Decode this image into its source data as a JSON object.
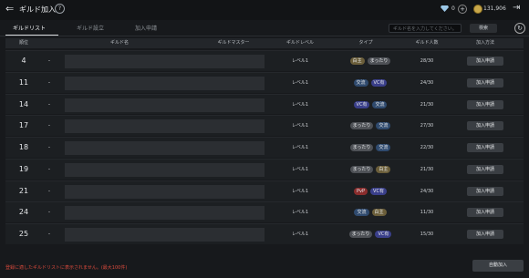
{
  "header": {
    "back_icon": "back-arrow-icon",
    "title": "ギルド加入",
    "help_glyph": "?",
    "gem_value": "0",
    "plus_glyph": "+",
    "gold_value": "131,906",
    "exit_icon": "exit-icon"
  },
  "tabs": [
    {
      "label": "ギルドリスト",
      "active": true
    },
    {
      "label": "ギルド設立",
      "active": false
    },
    {
      "label": "加入申請",
      "active": false
    }
  ],
  "search": {
    "placeholder": "ギルド名を入力してください。",
    "button_label": "検索",
    "refresh_icon": "refresh-icon"
  },
  "table": {
    "headers": {
      "rank": "順位",
      "name": "ギルド名",
      "master": "ギルドマスター",
      "level": "ギルドレベル",
      "type": "タイプ",
      "members": "ギルド人数",
      "method": "加入方法"
    },
    "rows": [
      {
        "rank": "4",
        "dash": "-",
        "level": "レベル1",
        "tags": [
          {
            "label": "白主",
            "kind": "shiro"
          },
          {
            "label": "まったり",
            "kind": "mattari"
          }
        ],
        "members": "28/30",
        "button": "加入申請"
      },
      {
        "rank": "11",
        "dash": "-",
        "level": "レベル1",
        "tags": [
          {
            "label": "交流",
            "kind": "koryu"
          },
          {
            "label": "VC有",
            "kind": "vc"
          }
        ],
        "members": "24/30",
        "button": "加入申請"
      },
      {
        "rank": "14",
        "dash": "-",
        "level": "レベル1",
        "tags": [
          {
            "label": "VC有",
            "kind": "vc"
          },
          {
            "label": "交流",
            "kind": "koryu"
          }
        ],
        "members": "21/30",
        "button": "加入申請"
      },
      {
        "rank": "17",
        "dash": "-",
        "level": "レベル1",
        "tags": [
          {
            "label": "まったり",
            "kind": "mattari"
          },
          {
            "label": "交流",
            "kind": "koryu"
          }
        ],
        "members": "27/30",
        "button": "加入申請"
      },
      {
        "rank": "18",
        "dash": "-",
        "level": "レベル1",
        "tags": [
          {
            "label": "まったり",
            "kind": "mattari"
          },
          {
            "label": "交流",
            "kind": "koryu"
          }
        ],
        "members": "22/30",
        "button": "加入申請"
      },
      {
        "rank": "19",
        "dash": "-",
        "level": "レベル1",
        "tags": [
          {
            "label": "まったり",
            "kind": "mattari"
          },
          {
            "label": "白主",
            "kind": "shiro"
          }
        ],
        "members": "21/30",
        "button": "加入申請"
      },
      {
        "rank": "21",
        "dash": "-",
        "level": "レベル1",
        "tags": [
          {
            "label": "PvP",
            "kind": "pvp"
          },
          {
            "label": "VC有",
            "kind": "vc"
          }
        ],
        "members": "24/30",
        "button": "加入申請"
      },
      {
        "rank": "24",
        "dash": "-",
        "level": "レベル1",
        "tags": [
          {
            "label": "交流",
            "kind": "koryu"
          },
          {
            "label": "白主",
            "kind": "shiro"
          }
        ],
        "members": "11/30",
        "button": "加入申請"
      },
      {
        "rank": "25",
        "dash": "-",
        "level": "レベル1",
        "tags": [
          {
            "label": "まったり",
            "kind": "mattari"
          },
          {
            "label": "VC有",
            "kind": "vc"
          }
        ],
        "members": "15/30",
        "button": "加入申請"
      }
    ]
  },
  "tag_colors": {
    "shiro": "#6b5e3a",
    "mattari": "#4e5156",
    "koryu": "#2f4a6e",
    "vc": "#3a3f8a",
    "pvp": "#8a2d2d"
  },
  "footer": {
    "note": "登録に適したギルドリストに表示されません。(最大100件)",
    "auto_join_label": "自動加入"
  }
}
